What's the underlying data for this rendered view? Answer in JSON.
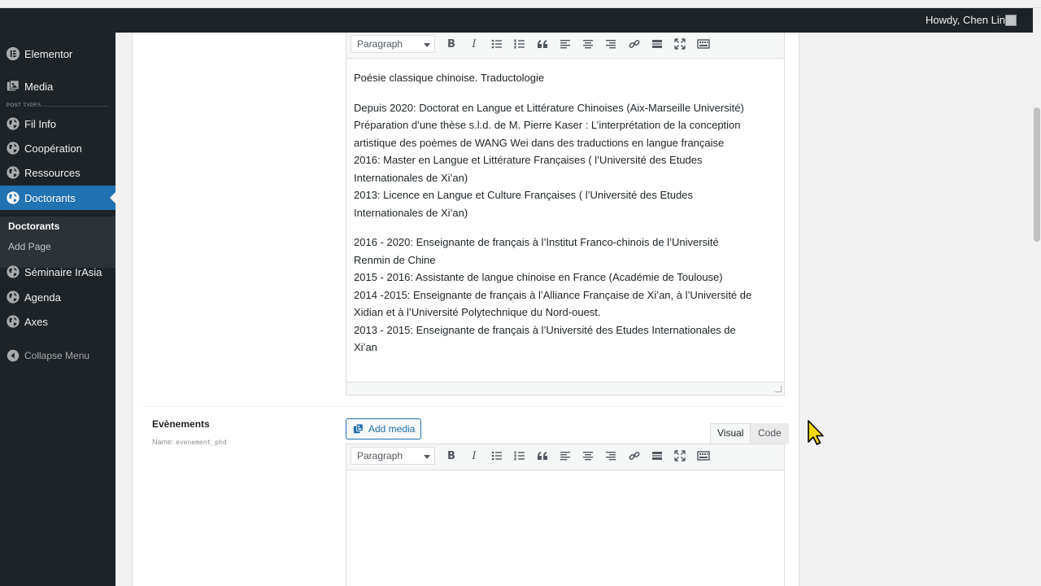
{
  "adminbar": {
    "greeting": "Howdy, Chen Lin"
  },
  "sidebar": {
    "items": [
      {
        "label": "Elementor",
        "icon": "elementor-icon"
      },
      {
        "label": "Media",
        "icon": "media-icon"
      },
      {
        "label": "Fil Info",
        "icon": "globe-icon"
      },
      {
        "label": "Coopération",
        "icon": "globe-icon"
      },
      {
        "label": "Ressources",
        "icon": "globe-icon"
      },
      {
        "label": "Doctorants",
        "icon": "globe-icon"
      },
      {
        "label": "Séminaire IrAsia",
        "icon": "globe-icon"
      },
      {
        "label": "Agenda",
        "icon": "globe-icon"
      },
      {
        "label": "Axes",
        "icon": "globe-icon"
      }
    ],
    "separator_label": "POST TYPES",
    "submenu": {
      "current": "Doctorants",
      "add": "Add Page"
    },
    "collapse_label": "Collapse Menu"
  },
  "editor1": {
    "format": "Paragraph",
    "paragraphs": [
      [
        "Poésie classique chinoise.  Traductologie"
      ],
      [
        "Depuis 2020: Doctorat en Langue et Littérature Chinoises (Aix-Marseille Université)",
        "Préparation d’une thèse s.l.d. de M. Pierre Kaser :  L’interprétation de la conception",
        "artistique des poèmes de WANG Wei dans des traductions en langue française",
        "2016: Master en Langue et Littérature Françaises ( l’Université des Etudes",
        "Internationales de Xi’an)",
        "2013: Licence en Langue et Culture Françaises ( l’Université des Etudes",
        "Internationales de Xi’an)"
      ],
      [
        "2016 - 2020: Enseignante de français à l’Institut Franco-chinois de l’Université",
        "Renmin de Chine",
        "2015 - 2016: Assistante de langue chinoise en France (Académie de Toulouse)",
        "2014 -2015: Enseignante de français à l’Alliance Française de Xi’an, à l’Université de",
        "Xidian et à l’Université Polytechnique du Nord-ouest.",
        "2013 - 2015: Enseignante de français à l’Université des Etudes Internationales de",
        "Xi’an"
      ]
    ]
  },
  "field2": {
    "label": "Evènements",
    "name_prefix": "Name:",
    "name_value": "evenement_phd",
    "add_media": "Add media",
    "tab_visual": "Visual",
    "tab_code": "Code",
    "format": "Paragraph"
  },
  "colors": {
    "admin_dark": "#1d2327",
    "accent": "#2271b1"
  }
}
